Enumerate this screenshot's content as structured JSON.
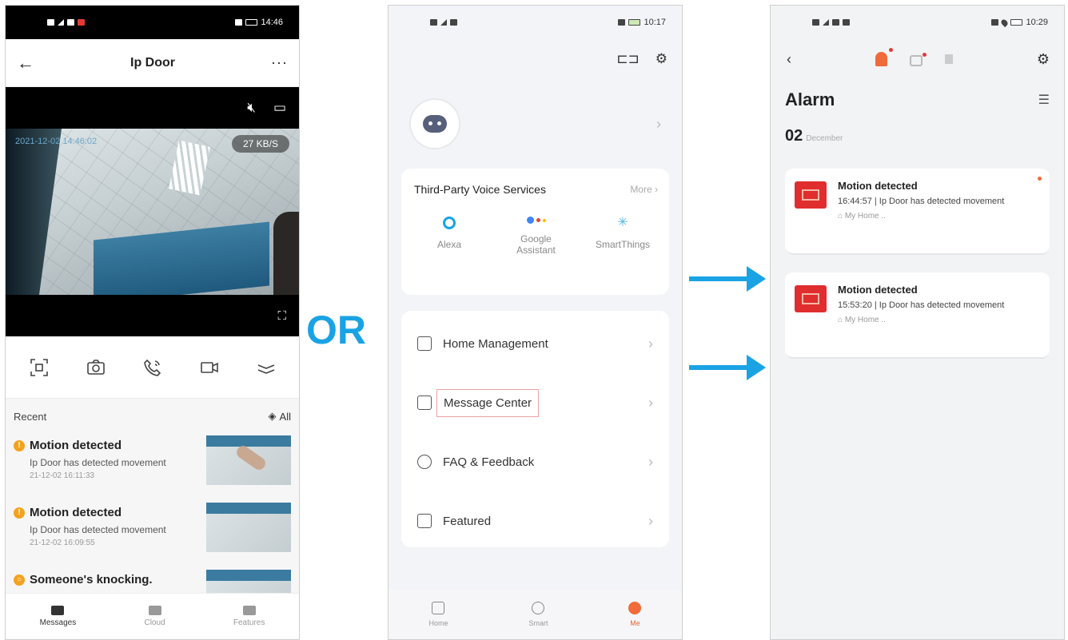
{
  "or_label": "OR",
  "accent_color": "#1aa3e4",
  "phone1": {
    "status": {
      "time": "14:46"
    },
    "header": {
      "back": "←",
      "title": "Ip Door",
      "more": "···"
    },
    "video": {
      "timestamp": "2021-12-02 14:46:02",
      "bitrate": "27 KB/S"
    },
    "recent": {
      "label": "Recent",
      "all": "All"
    },
    "events": [
      {
        "title": "Motion detected",
        "subtitle": "Ip Door has detected movement",
        "time": "21-12-02 16:11:33",
        "icon": "warning-dot"
      },
      {
        "title": "Motion detected",
        "subtitle": "Ip Door has detected movement",
        "time": "21-12-02 16:09:55",
        "icon": "warning-dot"
      },
      {
        "title": "Someone's knocking.",
        "subtitle": "",
        "time": "",
        "icon": "info-dot"
      }
    ],
    "tabs": [
      {
        "label": "Messages",
        "icon": "mail-icon"
      },
      {
        "label": "Cloud",
        "icon": "cloud-icon"
      },
      {
        "label": "Features",
        "icon": "grid-icon"
      }
    ]
  },
  "phone2": {
    "status": {
      "time": "10:17"
    },
    "voice_services": {
      "title": "Third-Party Voice Services",
      "more": "More",
      "items": [
        {
          "label": "Alexa"
        },
        {
          "label": "Google\nAssistant"
        },
        {
          "label": "SmartThings"
        }
      ]
    },
    "menu": [
      {
        "label": "Home Management"
      },
      {
        "label": "Message Center"
      },
      {
        "label": "FAQ & Feedback"
      },
      {
        "label": "Featured"
      }
    ],
    "tabs": [
      {
        "label": "Home"
      },
      {
        "label": "Smart"
      },
      {
        "label": "Me"
      }
    ]
  },
  "phone3": {
    "status": {
      "time": "10:29"
    },
    "title": "Alarm",
    "date": {
      "day": "02",
      "month": "December"
    },
    "alarms": [
      {
        "title": "Motion detected",
        "desc": "16:44:57 | Ip Door has detected movement",
        "home": "My Home .."
      },
      {
        "title": "Motion detected",
        "desc": "15:53:20 | Ip Door has detected movement",
        "home": "My Home .."
      }
    ]
  }
}
